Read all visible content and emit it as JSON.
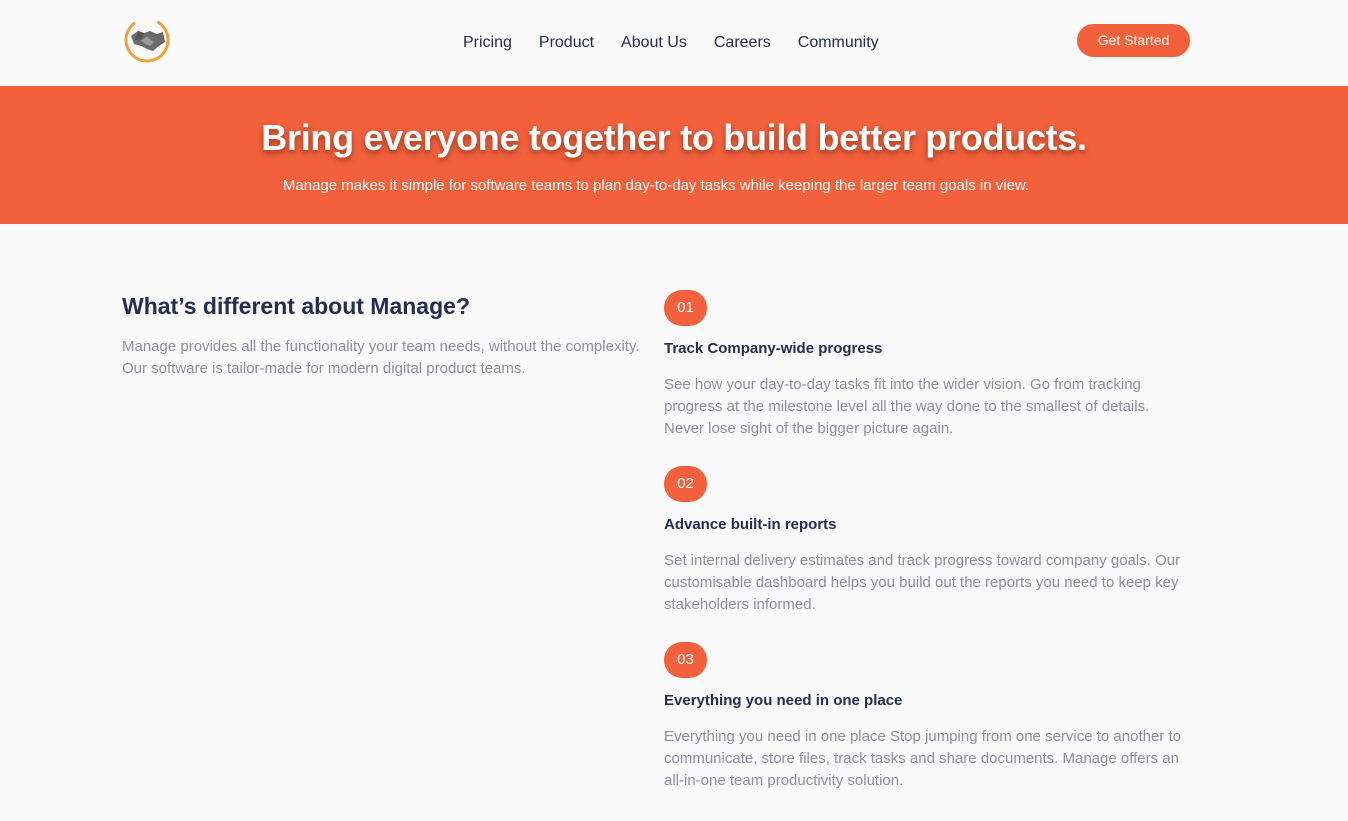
{
  "header": {
    "logo_name": "handshake-logo",
    "nav": [
      "Pricing",
      "Product",
      "About Us",
      "Careers",
      "Community"
    ],
    "cta_label": "Get Started"
  },
  "hero": {
    "title": "Bring everyone together to build better products.",
    "subtitle": "Manage makes it simple for software teams to plan day-to-day tasks while keeping the larger team goals in view."
  },
  "about": {
    "heading": "What’s different about Manage?",
    "body": "Manage provides all the functionality your team needs, without the complexity. Our software is tailor-made for modern digital product teams."
  },
  "features": [
    {
      "number": "01",
      "title": "Track Company-wide progress",
      "body": "See how your day-to-day tasks fit into the wider vision. Go from tracking progress at the milestone level all the way done to the smallest of details. Never lose sight of the bigger picture again."
    },
    {
      "number": "02",
      "title": "Advance built-in reports",
      "body": "Set internal delivery estimates and track progress toward company goals. Our customisable dashboard helps you build out the reports you need to keep key stakeholders informed."
    },
    {
      "number": "03",
      "title": "Everything you need in one place",
      "body": "Everything you need in one place Stop jumping from one service to another to communicate, store files, track tasks and share documents. Manage offers an all-in-one team productivity solution."
    }
  ],
  "colors": {
    "accent": "#f2603c",
    "heading": "#242d52",
    "muted": "#8c8f9f",
    "background": "#fafafa"
  }
}
